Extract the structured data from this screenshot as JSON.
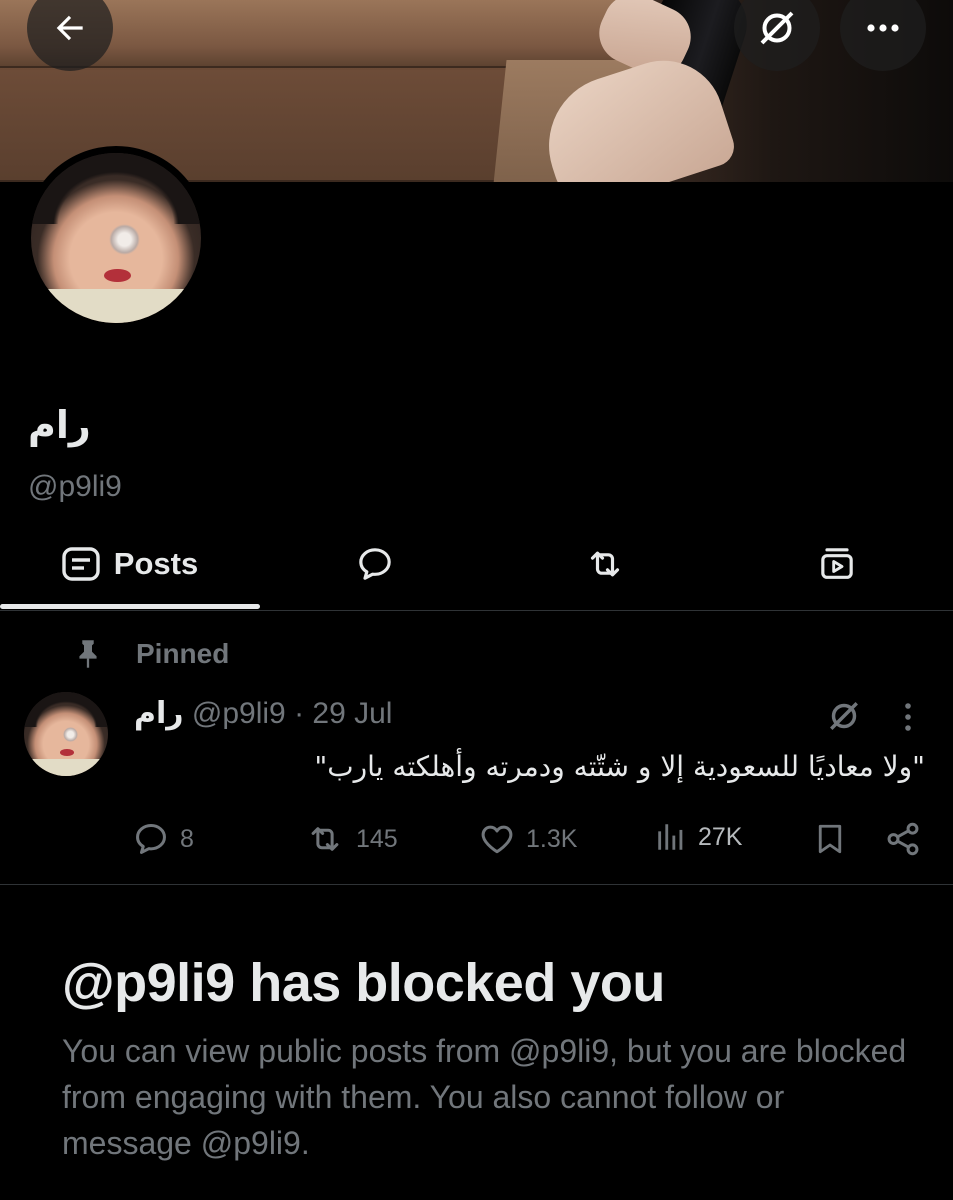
{
  "profile": {
    "display_name": "رام",
    "handle": "@p9li9"
  },
  "tabs": [
    {
      "id": "posts",
      "label": "Posts",
      "icon": "posts-icon",
      "active": true
    },
    {
      "id": "replies",
      "label": "",
      "icon": "reply-bubble-icon"
    },
    {
      "id": "reposts",
      "label": "",
      "icon": "repost-icon"
    },
    {
      "id": "media",
      "label": "",
      "icon": "media-play-icon"
    }
  ],
  "pinned_post": {
    "pinned_label": "Pinned",
    "author_name": "رام",
    "author_handle": "@p9li9",
    "separator": "·",
    "date": "29 Jul",
    "text": "\"ولا معاديًا للسعودية إلا و شتّته ودمرته وأهلكته يارب\"",
    "stats": {
      "replies": "8",
      "reposts": "145",
      "likes": "1.3K",
      "views": "27K"
    }
  },
  "blocked": {
    "title": "@p9li9 has blocked you",
    "message": "You can view public posts from @p9li9, but you are blocked from engaging with them. You also cannot follow or message @p9li9."
  },
  "colors": {
    "background": "#000000",
    "text_primary": "#e7e9ea",
    "text_secondary": "#71767b",
    "divider": "#2f3336"
  }
}
